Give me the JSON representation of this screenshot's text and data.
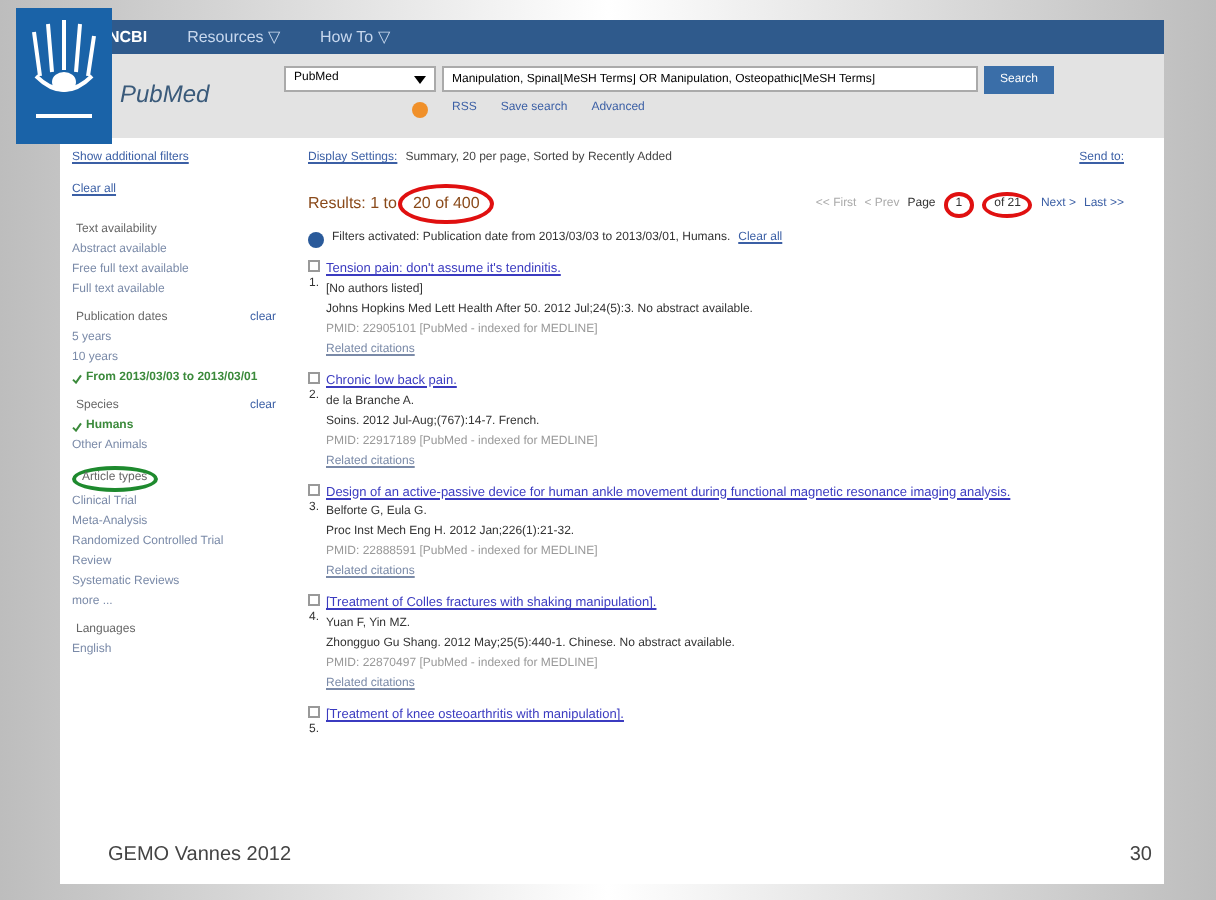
{
  "slide": {
    "footer": "GEMO Vannes 2012",
    "page_number": "30"
  },
  "ncbi_bar": {
    "items": [
      "NCBI",
      "Resources ▽",
      "How To ▽"
    ]
  },
  "search": {
    "logo": "PubMed",
    "database": "PubMed",
    "query": "Manipulation, Spinal[MeSH Terms] OR Manipulation, Osteopathic[MeSH Terms]",
    "button": "Search",
    "links": [
      "RSS",
      "Save search",
      "Advanced"
    ]
  },
  "sidebar": {
    "top_link": "Show additional filters",
    "clear": "Clear all",
    "groups": [
      {
        "title": "Text availability",
        "items": [
          {
            "label": "Abstract available",
            "checked": false
          },
          {
            "label": "Free full text available",
            "checked": false
          },
          {
            "label": "Full text available",
            "checked": false
          }
        ]
      },
      {
        "title": "Publication dates",
        "clear": "clear",
        "items": [
          {
            "label": "5 years",
            "checked": false
          },
          {
            "label": "10 years",
            "checked": false
          },
          {
            "label": "From 2013/03/03 to 2013/03/01",
            "checked": true
          }
        ]
      },
      {
        "title": "Species",
        "clear": "clear",
        "items": [
          {
            "label": "Humans",
            "checked": true
          },
          {
            "label": "Other Animals",
            "checked": false
          }
        ]
      },
      {
        "title": "Article types",
        "circled": true,
        "items": [
          {
            "label": "Clinical Trial",
            "checked": false
          },
          {
            "label": "Meta-Analysis",
            "checked": false
          },
          {
            "label": "Randomized Controlled Trial",
            "checked": false
          },
          {
            "label": "Review",
            "checked": false
          },
          {
            "label": "Systematic Reviews",
            "checked": false
          },
          {
            "label": "more ...",
            "checked": false
          }
        ]
      },
      {
        "title": "Languages",
        "items": [
          {
            "label": "English",
            "checked": false
          }
        ]
      }
    ]
  },
  "display": {
    "settings": "Display Settings:",
    "summary": "Summary, 20 per page, Sorted by Recently Added",
    "send_to": "Send to:"
  },
  "results": {
    "count": "Results: 1 to",
    "count_range": "20 of 400",
    "pager": {
      "first": "<< First",
      "prev": "< Prev",
      "page_label": "Page",
      "page": "1",
      "of": "of 21",
      "next": "Next >",
      "last": "Last >>"
    },
    "filters": "Filters activated: Publication date from 2013/03/03 to 2013/03/01, Humans.",
    "filters_clear": "Clear all"
  },
  "items": [
    {
      "checked": false,
      "number": "1.",
      "title": "Tension pain: don't assume it's tendinitis.",
      "authors": "[No authors listed]",
      "source": "Johns Hopkins Med Lett Health After 50. 2012 Jul;24(5):3. No abstract available.",
      "pmid": "PMID: 22905101 [PubMed - indexed for MEDLINE]",
      "related": "Related citations"
    },
    {
      "checked": false,
      "number": "2.",
      "title": "Chronic low back pain.",
      "authors": "de la Branche A.",
      "source": "Soins. 2012 Jul-Aug;(767):14-7. French.",
      "pmid": "PMID: 22917189 [PubMed - indexed for MEDLINE]",
      "related": "Related citations"
    },
    {
      "checked": false,
      "number": "3.",
      "title": "Design of an active-passive device for human ankle movement during functional magnetic resonance imaging analysis.",
      "authors": "Belforte G, Eula G.",
      "source": "Proc Inst Mech Eng H. 2012 Jan;226(1):21-32.",
      "pmid": "PMID: 22888591 [PubMed - indexed for MEDLINE]",
      "related": "Related citations"
    },
    {
      "checked": false,
      "number": "4.",
      "title": "[Treatment of Colles fractures with shaking manipulation].",
      "authors": "Yuan F, Yin MZ.",
      "source": "Zhongguo Gu Shang. 2012 May;25(5):440-1. Chinese. No abstract available.",
      "pmid": "PMID: 22870497 [PubMed - indexed for MEDLINE]",
      "related": "Related citations"
    },
    {
      "checked": false,
      "number": "5.",
      "title": "[Treatment of knee osteoarthritis with manipulation]."
    }
  ]
}
